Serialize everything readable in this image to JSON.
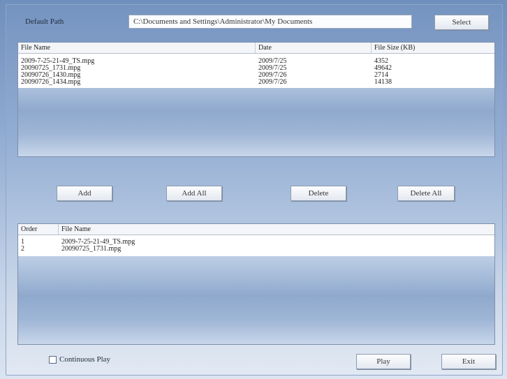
{
  "header": {
    "default_path_label": "Default Path",
    "path_value": "C:\\Documents and Settings\\Administrator\\My Documents",
    "select_label": "Select"
  },
  "source_list": {
    "columns": [
      "File Name",
      "Date",
      "File Size (KB)"
    ],
    "rows": [
      [
        "2009-7-25-21-49_TS.mpg",
        "2009/7/25",
        "4352"
      ],
      [
        "20090725_1731.mpg",
        "2009/7/25",
        "49642"
      ],
      [
        "20090726_1430.mpg",
        "2009/7/26",
        "2714"
      ],
      [
        "20090726_1434.mpg",
        "2009/7/26",
        "14138"
      ]
    ]
  },
  "actions": {
    "add": "Add",
    "add_all": "Add All",
    "delete": "Delete",
    "delete_all": "Delete All"
  },
  "playlist": {
    "columns": [
      "Order",
      "File Name"
    ],
    "rows": [
      [
        "1",
        "2009-7-25-21-49_TS.mpg"
      ],
      [
        "2",
        "20090725_1731.mpg"
      ]
    ]
  },
  "footer": {
    "continuous_play_label": "Continuous Play",
    "continuous_play_checked": false,
    "play_label": "Play",
    "exit_label": "Exit"
  }
}
